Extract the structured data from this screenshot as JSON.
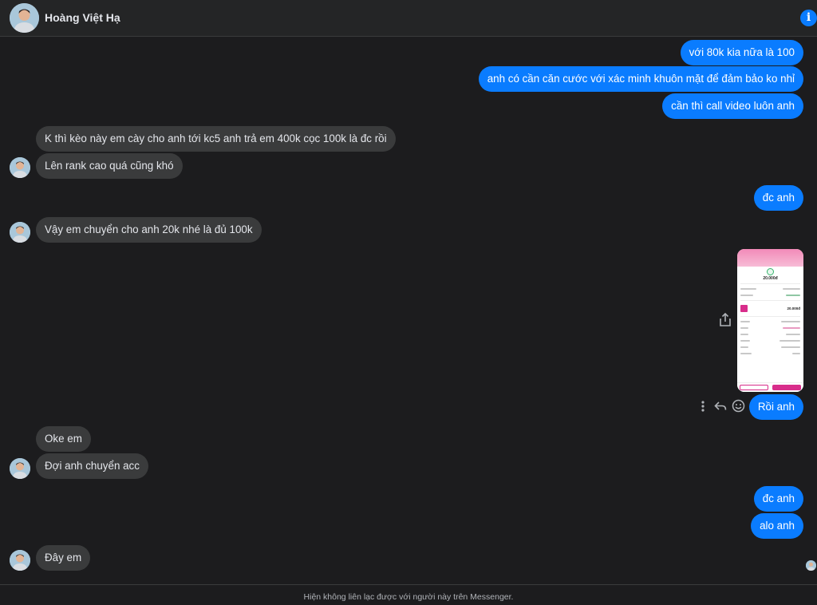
{
  "header": {
    "contact_name": "Hoàng Việt Hạ",
    "info_icon": "info-icon"
  },
  "messages": [
    {
      "side": "out",
      "text": "với 80k kia nữa là 100"
    },
    {
      "side": "out",
      "text": "anh có cần căn cước với xác minh khuôn mặt để đảm bảo ko nhỉ"
    },
    {
      "side": "out",
      "text": "cần thì call video luôn anh"
    },
    {
      "side": "in",
      "text": "K thì kèo này em cày cho anh tới kc5 anh trả em 400k cọc 100k là đc rồi"
    },
    {
      "side": "in",
      "text": "Lên rank cao quá cũng khó"
    },
    {
      "side": "out",
      "text": "đc anh"
    },
    {
      "side": "in",
      "text": "Vậy em chuyển cho anh 20k nhé là đủ 100k"
    },
    {
      "side": "out",
      "type": "image",
      "image_alt": "payment-receipt-screenshot",
      "amount": "20.000đ",
      "amount_card": "20.000đ"
    },
    {
      "side": "out",
      "text": "Rồi anh"
    },
    {
      "side": "in",
      "text": "Oke em"
    },
    {
      "side": "in",
      "text": "Đợi anh chuyển acc"
    },
    {
      "side": "out",
      "text": "đc anh"
    },
    {
      "side": "out",
      "text": "alo anh"
    },
    {
      "side": "in",
      "text": "Đây em"
    }
  ],
  "message_actions": {
    "more_icon": "more-vertical-icon",
    "reply_icon": "reply-icon",
    "react_icon": "smiley-icon",
    "share_icon": "share-icon"
  },
  "footer": {
    "notice": "Hiện không liên lạc được với người này trên Messenger."
  },
  "colors": {
    "background": "#1c1c1e",
    "outgoing_bubble": "#0a7cff",
    "incoming_bubble": "#3a3b3c",
    "text": "#e4e6eb"
  }
}
